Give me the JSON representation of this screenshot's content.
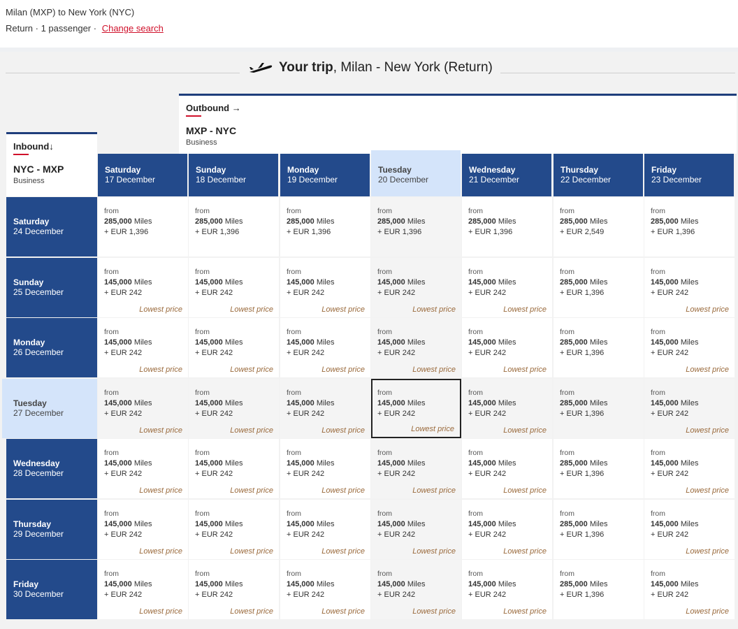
{
  "search": {
    "route": "Milan (MXP) to New York (NYC)",
    "details": "Return · 1 passenger ·",
    "change_link": "Change search"
  },
  "trip": {
    "title_bold": "Your trip",
    "title_rest": ", Milan - New York (Return)",
    "icon": "plane-icon"
  },
  "outbound": {
    "label": "Outbound →",
    "route": "MXP - NYC",
    "cabin": "Business"
  },
  "inbound": {
    "label": "Inbound↓",
    "route": "NYC - MXP",
    "cabin": "Business"
  },
  "colors": {
    "header_blue": "#234a8b",
    "selected_header": "#d4e4fa",
    "accent_red": "#d0112b",
    "lowest_price": "#9a6a3c"
  },
  "columns": [
    {
      "day": "Saturday",
      "date": "17 December"
    },
    {
      "day": "Sunday",
      "date": "18 December"
    },
    {
      "day": "Monday",
      "date": "19 December"
    },
    {
      "day": "Tuesday",
      "date": "20 December",
      "selected": true
    },
    {
      "day": "Wednesday",
      "date": "21 December"
    },
    {
      "day": "Thursday",
      "date": "22 December"
    },
    {
      "day": "Friday",
      "date": "23 December"
    }
  ],
  "rows": [
    {
      "day": "Saturday",
      "date": "24 December",
      "cells": [
        {
          "from": "from",
          "miles": "285,000",
          "miles_unit": "Miles",
          "eur": "+ EUR 1,396",
          "lowest": ""
        },
        {
          "from": "from",
          "miles": "285,000",
          "miles_unit": "Miles",
          "eur": "+ EUR 1,396",
          "lowest": ""
        },
        {
          "from": "from",
          "miles": "285,000",
          "miles_unit": "Miles",
          "eur": "+ EUR 1,396",
          "lowest": ""
        },
        {
          "from": "from",
          "miles": "285,000",
          "miles_unit": "Miles",
          "eur": "+ EUR 1,396",
          "lowest": ""
        },
        {
          "from": "from",
          "miles": "285,000",
          "miles_unit": "Miles",
          "eur": "+ EUR 1,396",
          "lowest": ""
        },
        {
          "from": "from",
          "miles": "285,000",
          "miles_unit": "Miles",
          "eur": "+ EUR 2,549",
          "lowest": ""
        },
        {
          "from": "from",
          "miles": "285,000",
          "miles_unit": "Miles",
          "eur": "+ EUR 1,396",
          "lowest": ""
        }
      ]
    },
    {
      "day": "Sunday",
      "date": "25 December",
      "cells": [
        {
          "from": "from",
          "miles": "145,000",
          "miles_unit": "Miles",
          "eur": "+ EUR 242",
          "lowest": "Lowest price"
        },
        {
          "from": "from",
          "miles": "145,000",
          "miles_unit": "Miles",
          "eur": "+ EUR 242",
          "lowest": "Lowest price"
        },
        {
          "from": "from",
          "miles": "145,000",
          "miles_unit": "Miles",
          "eur": "+ EUR 242",
          "lowest": "Lowest price"
        },
        {
          "from": "from",
          "miles": "145,000",
          "miles_unit": "Miles",
          "eur": "+ EUR 242",
          "lowest": "Lowest price"
        },
        {
          "from": "from",
          "miles": "145,000",
          "miles_unit": "Miles",
          "eur": "+ EUR 242",
          "lowest": "Lowest price"
        },
        {
          "from": "from",
          "miles": "285,000",
          "miles_unit": "Miles",
          "eur": "+ EUR 1,396",
          "lowest": ""
        },
        {
          "from": "from",
          "miles": "145,000",
          "miles_unit": "Miles",
          "eur": "+ EUR 242",
          "lowest": "Lowest price"
        }
      ]
    },
    {
      "day": "Monday",
      "date": "26 December",
      "cells": [
        {
          "from": "from",
          "miles": "145,000",
          "miles_unit": "Miles",
          "eur": "+ EUR 242",
          "lowest": "Lowest price"
        },
        {
          "from": "from",
          "miles": "145,000",
          "miles_unit": "Miles",
          "eur": "+ EUR 242",
          "lowest": "Lowest price"
        },
        {
          "from": "from",
          "miles": "145,000",
          "miles_unit": "Miles",
          "eur": "+ EUR 242",
          "lowest": "Lowest price"
        },
        {
          "from": "from",
          "miles": "145,000",
          "miles_unit": "Miles",
          "eur": "+ EUR 242",
          "lowest": "Lowest price"
        },
        {
          "from": "from",
          "miles": "145,000",
          "miles_unit": "Miles",
          "eur": "+ EUR 242",
          "lowest": "Lowest price"
        },
        {
          "from": "from",
          "miles": "285,000",
          "miles_unit": "Miles",
          "eur": "+ EUR 1,396",
          "lowest": ""
        },
        {
          "from": "from",
          "miles": "145,000",
          "miles_unit": "Miles",
          "eur": "+ EUR 242",
          "lowest": "Lowest price"
        }
      ]
    },
    {
      "day": "Tuesday",
      "date": "27 December",
      "selected": true,
      "cells": [
        {
          "from": "from",
          "miles": "145,000",
          "miles_unit": "Miles",
          "eur": "+ EUR 242",
          "lowest": "Lowest price"
        },
        {
          "from": "from",
          "miles": "145,000",
          "miles_unit": "Miles",
          "eur": "+ EUR 242",
          "lowest": "Lowest price"
        },
        {
          "from": "from",
          "miles": "145,000",
          "miles_unit": "Miles",
          "eur": "+ EUR 242",
          "lowest": "Lowest price"
        },
        {
          "from": "from",
          "miles": "145,000",
          "miles_unit": "Miles",
          "eur": "+ EUR 242",
          "lowest": "Lowest price"
        },
        {
          "from": "from",
          "miles": "145,000",
          "miles_unit": "Miles",
          "eur": "+ EUR 242",
          "lowest": "Lowest price"
        },
        {
          "from": "from",
          "miles": "285,000",
          "miles_unit": "Miles",
          "eur": "+ EUR 1,396",
          "lowest": ""
        },
        {
          "from": "from",
          "miles": "145,000",
          "miles_unit": "Miles",
          "eur": "+ EUR 242",
          "lowest": "Lowest price"
        }
      ]
    },
    {
      "day": "Wednesday",
      "date": "28 December",
      "cells": [
        {
          "from": "from",
          "miles": "145,000",
          "miles_unit": "Miles",
          "eur": "+ EUR 242",
          "lowest": "Lowest price"
        },
        {
          "from": "from",
          "miles": "145,000",
          "miles_unit": "Miles",
          "eur": "+ EUR 242",
          "lowest": "Lowest price"
        },
        {
          "from": "from",
          "miles": "145,000",
          "miles_unit": "Miles",
          "eur": "+ EUR 242",
          "lowest": "Lowest price"
        },
        {
          "from": "from",
          "miles": "145,000",
          "miles_unit": "Miles",
          "eur": "+ EUR 242",
          "lowest": "Lowest price"
        },
        {
          "from": "from",
          "miles": "145,000",
          "miles_unit": "Miles",
          "eur": "+ EUR 242",
          "lowest": "Lowest price"
        },
        {
          "from": "from",
          "miles": "285,000",
          "miles_unit": "Miles",
          "eur": "+ EUR 1,396",
          "lowest": ""
        },
        {
          "from": "from",
          "miles": "145,000",
          "miles_unit": "Miles",
          "eur": "+ EUR 242",
          "lowest": "Lowest price"
        }
      ]
    },
    {
      "day": "Thursday",
      "date": "29 December",
      "cells": [
        {
          "from": "from",
          "miles": "145,000",
          "miles_unit": "Miles",
          "eur": "+ EUR 242",
          "lowest": "Lowest price"
        },
        {
          "from": "from",
          "miles": "145,000",
          "miles_unit": "Miles",
          "eur": "+ EUR 242",
          "lowest": "Lowest price"
        },
        {
          "from": "from",
          "miles": "145,000",
          "miles_unit": "Miles",
          "eur": "+ EUR 242",
          "lowest": "Lowest price"
        },
        {
          "from": "from",
          "miles": "145,000",
          "miles_unit": "Miles",
          "eur": "+ EUR 242",
          "lowest": "Lowest price"
        },
        {
          "from": "from",
          "miles": "145,000",
          "miles_unit": "Miles",
          "eur": "+ EUR 242",
          "lowest": "Lowest price"
        },
        {
          "from": "from",
          "miles": "285,000",
          "miles_unit": "Miles",
          "eur": "+ EUR 1,396",
          "lowest": ""
        },
        {
          "from": "from",
          "miles": "145,000",
          "miles_unit": "Miles",
          "eur": "+ EUR 242",
          "lowest": "Lowest price"
        }
      ]
    },
    {
      "day": "Friday",
      "date": "30 December",
      "cells": [
        {
          "from": "from",
          "miles": "145,000",
          "miles_unit": "Miles",
          "eur": "+ EUR 242",
          "lowest": "Lowest price"
        },
        {
          "from": "from",
          "miles": "145,000",
          "miles_unit": "Miles",
          "eur": "+ EUR 242",
          "lowest": "Lowest price"
        },
        {
          "from": "from",
          "miles": "145,000",
          "miles_unit": "Miles",
          "eur": "+ EUR 242",
          "lowest": "Lowest price"
        },
        {
          "from": "from",
          "miles": "145,000",
          "miles_unit": "Miles",
          "eur": "+ EUR 242",
          "lowest": "Lowest price"
        },
        {
          "from": "from",
          "miles": "145,000",
          "miles_unit": "Miles",
          "eur": "+ EUR 242",
          "lowest": "Lowest price"
        },
        {
          "from": "from",
          "miles": "285,000",
          "miles_unit": "Miles",
          "eur": "+ EUR 1,396",
          "lowest": ""
        },
        {
          "from": "from",
          "miles": "145,000",
          "miles_unit": "Miles",
          "eur": "+ EUR 242",
          "lowest": "Lowest price"
        }
      ]
    }
  ]
}
